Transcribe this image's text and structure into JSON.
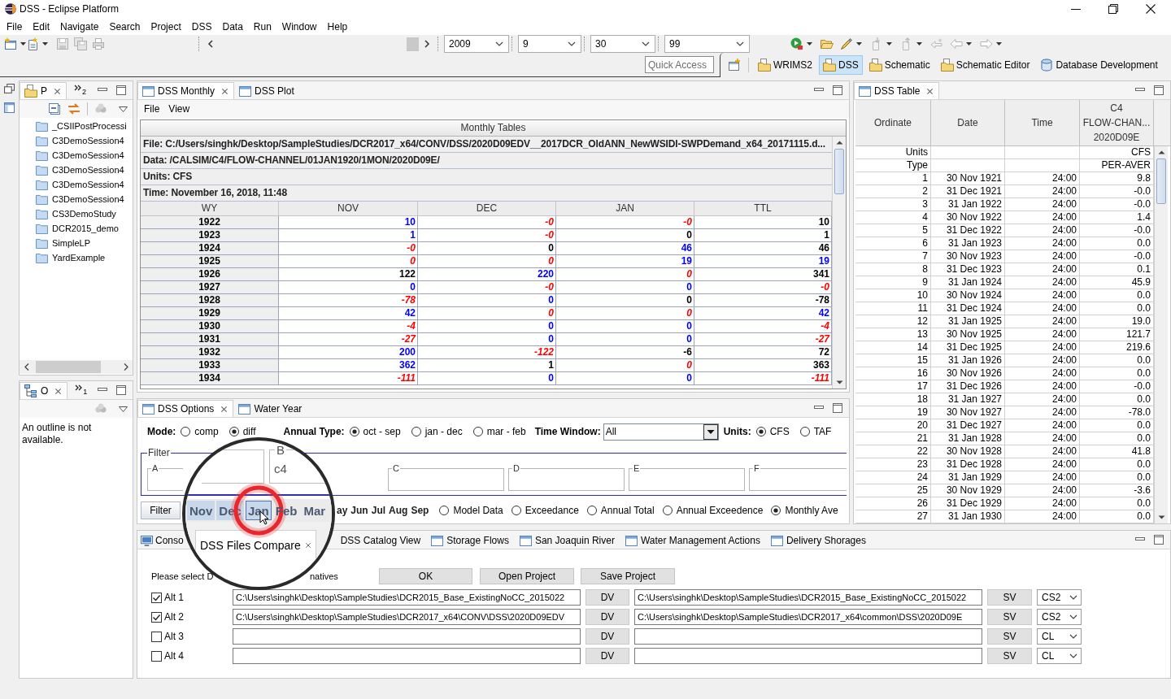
{
  "window": {
    "title": "DSS - Eclipse Platform"
  },
  "menu": [
    "File",
    "Edit",
    "Navigate",
    "Search",
    "Project",
    "DSS",
    "Data",
    "Run",
    "Window",
    "Help"
  ],
  "toolbar": {
    "combos": [
      "2009",
      "9",
      "30",
      "99"
    ]
  },
  "quick_access": {
    "placeholder": "Quick Access"
  },
  "perspectives": [
    {
      "label": "WRIMS2",
      "kind": "folder",
      "selected": false
    },
    {
      "label": "DSS",
      "kind": "folder",
      "selected": true
    },
    {
      "label": "Schematic",
      "kind": "folder",
      "selected": false
    },
    {
      "label": "Schematic Editor",
      "kind": "folder",
      "selected": false
    },
    {
      "label": "Database Development",
      "kind": "database",
      "selected": false
    }
  ],
  "explorer": {
    "tab": {
      "label": "P",
      "selected": true
    },
    "overflow": "2",
    "items": [
      "_CSIIPostProcessi",
      "C3DemoSession4",
      "C3DemoSession4",
      "C3DemoSession4",
      "C3DemoSession4",
      "C3DemoSession4",
      "CS3DemoStudy",
      "DCR2015_demo",
      "SimpleLP",
      "YardExample"
    ]
  },
  "outline": {
    "tab": {
      "label": "O",
      "selected": true
    },
    "overflow": "1",
    "message": "An outline is not available."
  },
  "monthly": {
    "tabs": [
      {
        "label": "DSS Monthly",
        "selected": true
      },
      {
        "label": "DSS Plot",
        "selected": false
      }
    ],
    "menu": [
      "File",
      "View"
    ],
    "title": "Monthly Tables",
    "info": [
      "File: C:/Users/singhk/Desktop/SampleStudies/DCR2017_x64/CONV/DSS/2020D09EDV__2017DCR_OldANN_NewWSIDI-SWPDemand_x64_20171115.d...",
      "Data: /CALSIM/C4/FLOW-CHANNEL/01JAN1920/1MON/2020D09E/",
      "Units: CFS",
      "Time: November 16, 2018, 11:48"
    ],
    "columns": [
      "WY",
      "NOV",
      "DEC",
      "JAN",
      "TTL"
    ],
    "rows": [
      {
        "wy": "1922",
        "cells": [
          {
            "value": "10",
            "color": "#0000ff",
            "italic": false
          },
          {
            "value": "-0",
            "color": "#ff0000",
            "italic": true
          },
          {
            "value": "-0",
            "color": "#ff0000",
            "italic": true
          },
          {
            "value": "10",
            "color": "#000000",
            "italic": false
          }
        ]
      },
      {
        "wy": "1923",
        "cells": [
          {
            "value": "1",
            "color": "#0000ff",
            "italic": false
          },
          {
            "value": "-0",
            "color": "#ff0000",
            "italic": true
          },
          {
            "value": "0",
            "color": "#000000",
            "italic": false
          },
          {
            "value": "1",
            "color": "#000000",
            "italic": false
          }
        ]
      },
      {
        "wy": "1924",
        "cells": [
          {
            "value": "-0",
            "color": "#ff0000",
            "italic": true
          },
          {
            "value": "0",
            "color": "#000000",
            "italic": false
          },
          {
            "value": "46",
            "color": "#0000ff",
            "italic": false
          },
          {
            "value": "46",
            "color": "#000000",
            "italic": false
          }
        ]
      },
      {
        "wy": "1925",
        "cells": [
          {
            "value": "0",
            "color": "#ff0000",
            "italic": true
          },
          {
            "value": "0",
            "color": "#ff0000",
            "italic": true
          },
          {
            "value": "19",
            "color": "#0000ff",
            "italic": false
          },
          {
            "value": "19",
            "color": "#0000ff",
            "italic": false
          }
        ]
      },
      {
        "wy": "1926",
        "cells": [
          {
            "value": "122",
            "color": "#000000",
            "italic": false
          },
          {
            "value": "220",
            "color": "#0000ff",
            "italic": false
          },
          {
            "value": "0",
            "color": "#ff0000",
            "italic": true
          },
          {
            "value": "341",
            "color": "#000000",
            "italic": false
          }
        ]
      },
      {
        "wy": "1927",
        "cells": [
          {
            "value": "0",
            "color": "#0000ff",
            "italic": false
          },
          {
            "value": "-0",
            "color": "#ff0000",
            "italic": true
          },
          {
            "value": "0",
            "color": "#0000ff",
            "italic": false
          },
          {
            "value": "-0",
            "color": "#ff0000",
            "italic": true
          }
        ]
      },
      {
        "wy": "1928",
        "cells": [
          {
            "value": "-78",
            "color": "#ff0000",
            "italic": true
          },
          {
            "value": "0",
            "color": "#0000ff",
            "italic": false
          },
          {
            "value": "0",
            "color": "#000000",
            "italic": false
          },
          {
            "value": "-78",
            "color": "#000000",
            "italic": false
          }
        ]
      },
      {
        "wy": "1929",
        "cells": [
          {
            "value": "42",
            "color": "#0000ff",
            "italic": false
          },
          {
            "value": "0",
            "color": "#ff0000",
            "italic": true
          },
          {
            "value": "0",
            "color": "#ff0000",
            "italic": true
          },
          {
            "value": "42",
            "color": "#0000ff",
            "italic": false
          }
        ]
      },
      {
        "wy": "1930",
        "cells": [
          {
            "value": "-4",
            "color": "#ff0000",
            "italic": true
          },
          {
            "value": "0",
            "color": "#0000ff",
            "italic": false
          },
          {
            "value": "0",
            "color": "#0000ff",
            "italic": false
          },
          {
            "value": "-4",
            "color": "#ff0000",
            "italic": true
          }
        ]
      },
      {
        "wy": "1931",
        "cells": [
          {
            "value": "-27",
            "color": "#ff0000",
            "italic": true
          },
          {
            "value": "0",
            "color": "#0000ff",
            "italic": false
          },
          {
            "value": "0",
            "color": "#0000ff",
            "italic": false
          },
          {
            "value": "-27",
            "color": "#ff0000",
            "italic": true
          }
        ]
      },
      {
        "wy": "1932",
        "cells": [
          {
            "value": "200",
            "color": "#0000ff",
            "italic": false
          },
          {
            "value": "-122",
            "color": "#ff0000",
            "italic": true
          },
          {
            "value": "-6",
            "color": "#000000",
            "italic": false
          },
          {
            "value": "72",
            "color": "#000000",
            "italic": false
          }
        ]
      },
      {
        "wy": "1933",
        "cells": [
          {
            "value": "362",
            "color": "#0000ff",
            "italic": false
          },
          {
            "value": "1",
            "color": "#000000",
            "italic": false
          },
          {
            "value": "0",
            "color": "#ff0000",
            "italic": true
          },
          {
            "value": "363",
            "color": "#000000",
            "italic": false
          }
        ]
      },
      {
        "wy": "1934",
        "cells": [
          {
            "value": "-111",
            "color": "#ff0000",
            "italic": true
          },
          {
            "value": "0",
            "color": "#0000ff",
            "italic": false
          },
          {
            "value": "0",
            "color": "#0000ff",
            "italic": false
          },
          {
            "value": "-111",
            "color": "#ff0000",
            "italic": true
          }
        ]
      }
    ]
  },
  "options": {
    "tabs": [
      {
        "label": "DSS Options",
        "selected": true
      },
      {
        "label": "Water Year",
        "selected": false
      }
    ],
    "mode": {
      "label": "Mode:",
      "choices": [
        {
          "label": "comp",
          "selected": false
        },
        {
          "label": "diff",
          "selected": true
        }
      ]
    },
    "annual_type": {
      "label": "Annual Type:",
      "choices": [
        {
          "label": "oct - sep",
          "selected": true
        },
        {
          "label": "jan - dec",
          "selected": false
        },
        {
          "label": "mar - feb",
          "selected": false
        }
      ]
    },
    "time_window": {
      "label": "Time Window:",
      "value": "All"
    },
    "units": {
      "label": "Units:",
      "choices": [
        {
          "label": "CFS",
          "selected": true
        },
        {
          "label": "TAF",
          "selected": false
        }
      ]
    },
    "filter": {
      "title": "Filter",
      "groups": [
        {
          "label": "A"
        },
        {
          "label": "C"
        },
        {
          "label": "D"
        },
        {
          "label": "E"
        },
        {
          "label": "F"
        }
      ]
    },
    "filter_button": "Filter",
    "months": [
      {
        "label": "ay",
        "selected": false
      },
      {
        "label": "Jun",
        "selected": false
      },
      {
        "label": "Jul",
        "selected": false
      },
      {
        "label": "Aug",
        "selected": false
      },
      {
        "label": "Sep",
        "selected": false
      }
    ],
    "displays": [
      {
        "label": "Model Data",
        "selected": false
      },
      {
        "label": "Exceedance",
        "selected": false
      },
      {
        "label": "Annual Total",
        "selected": false
      },
      {
        "label": "Annual Exceedence",
        "selected": false
      },
      {
        "label": "Monthly Ave",
        "selected": true
      }
    ]
  },
  "table_view": {
    "tab": {
      "label": "DSS Table",
      "selected": true
    },
    "columns": [
      "Ordinate",
      "Date",
      "Time",
      "C4\nFLOW-CHAN...\n2020D09E"
    ],
    "meta_rows": [
      {
        "label": "Units",
        "value": "CFS"
      },
      {
        "label": "Type",
        "value": "PER-AVER"
      }
    ],
    "rows": [
      [
        "1",
        "30 Nov 1921",
        "24:00",
        "9.8"
      ],
      [
        "2",
        "31 Dec 1921",
        "24:00",
        "-0.0"
      ],
      [
        "3",
        "31 Jan 1922",
        "24:00",
        "-0.0"
      ],
      [
        "4",
        "30 Nov 1922",
        "24:00",
        "1.4"
      ],
      [
        "5",
        "31 Dec 1922",
        "24:00",
        "-0.0"
      ],
      [
        "6",
        "31 Jan 1923",
        "24:00",
        "0.0"
      ],
      [
        "7",
        "30 Nov 1923",
        "24:00",
        "-0.0"
      ],
      [
        "8",
        "31 Dec 1923",
        "24:00",
        "0.1"
      ],
      [
        "9",
        "31 Jan 1924",
        "24:00",
        "45.9"
      ],
      [
        "10",
        "30 Nov 1924",
        "24:00",
        "0.0"
      ],
      [
        "11",
        "31 Dec 1924",
        "24:00",
        "0.0"
      ],
      [
        "12",
        "31 Jan 1925",
        "24:00",
        "19.0"
      ],
      [
        "13",
        "30 Nov 1925",
        "24:00",
        "121.7"
      ],
      [
        "14",
        "31 Dec 1925",
        "24:00",
        "219.6"
      ],
      [
        "15",
        "31 Jan 1926",
        "24:00",
        "0.0"
      ],
      [
        "16",
        "30 Nov 1926",
        "24:00",
        "0.0"
      ],
      [
        "17",
        "31 Dec 1926",
        "24:00",
        "-0.0"
      ],
      [
        "18",
        "31 Jan 1927",
        "24:00",
        "0.0"
      ],
      [
        "19",
        "30 Nov 1927",
        "24:00",
        "-78.0"
      ],
      [
        "20",
        "31 Dec 1927",
        "24:00",
        "0.0"
      ],
      [
        "21",
        "31 Jan 1928",
        "24:00",
        "0.0"
      ],
      [
        "22",
        "30 Nov 1928",
        "24:00",
        "41.8"
      ],
      [
        "23",
        "31 Dec 1928",
        "24:00",
        "0.0"
      ],
      [
        "24",
        "31 Jan 1929",
        "24:00",
        "0.0"
      ],
      [
        "25",
        "30 Nov 1929",
        "24:00",
        "-3.6"
      ],
      [
        "26",
        "31 Dec 1929",
        "24:00",
        "0.0"
      ],
      [
        "27",
        "31 Jan 1930",
        "24:00",
        "0.0"
      ]
    ]
  },
  "bottom": {
    "tabs": [
      {
        "label": "Conso",
        "kind": "console",
        "selected": false
      },
      {
        "label": "DSS Catalog View",
        "kind": "plain",
        "selected": false
      },
      {
        "label": "Storage Flows",
        "kind": "view",
        "selected": false
      },
      {
        "label": "San Joaquin River",
        "kind": "view",
        "selected": false
      },
      {
        "label": "Water Management Actions",
        "kind": "view",
        "selected": false
      },
      {
        "label": "Delivery Shorages",
        "kind": "view",
        "selected": false
      }
    ],
    "prompt_start": "Please select D",
    "prompt_end": "natives",
    "buttons": [
      "OK",
      "Open Project",
      "Save Project"
    ],
    "alternatives": [
      {
        "label": "Alt 1",
        "checked": true,
        "dv_path": "C:\\Users\\singhk\\Desktop\\SampleStudies\\DCR2015_Base_ExistingNoCC_2015022",
        "dv_button": "DV",
        "sv_path": "C:\\Users\\singhk\\Desktop\\SampleStudies\\DCR2015_Base_ExistingNoCC_2015022",
        "sv_button": "SV",
        "study": "CS2"
      },
      {
        "label": "Alt 2",
        "checked": true,
        "dv_path": "C:\\Users\\singhk\\Desktop\\SampleStudies\\DCR2017_x64\\CONV\\DSS\\2020D09EDV",
        "dv_button": "DV",
        "sv_path": "C:\\Users\\singhk\\Desktop\\SampleStudies\\DCR2017_x64\\common\\DSS\\2020D09E",
        "sv_button": "SV",
        "study": "CS2"
      },
      {
        "label": "Alt 3",
        "checked": false,
        "dv_button": "DV",
        "sv_button": "SV",
        "study": "CL"
      },
      {
        "label": "Alt 4",
        "checked": false,
        "dv_button": "DV",
        "sv_button": "SV",
        "study": "CL"
      }
    ]
  },
  "magnifier": {
    "filter": {
      "label": "B",
      "value": "c4"
    },
    "months": [
      {
        "label": "Nov",
        "selected": true,
        "clicked": false
      },
      {
        "label": "Dec",
        "selected": true,
        "clicked": false
      },
      {
        "label": "Jan",
        "selected": true,
        "clicked": true
      },
      {
        "label": "Feb",
        "selected": false,
        "clicked": false
      },
      {
        "label": "Mar",
        "selected": false,
        "clicked": false
      }
    ],
    "tab": {
      "label": "DSS Files Compare",
      "selected": true
    }
  }
}
